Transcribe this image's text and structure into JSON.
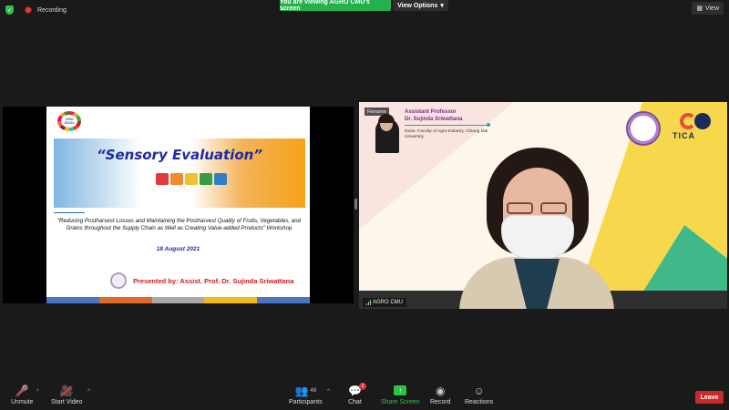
{
  "top": {
    "recording_label": "Recording",
    "banner_text": "You are viewing AGRO CMU's screen",
    "view_options_label": "View Options",
    "view_label": "View"
  },
  "slide": {
    "logo_text": "CMU SDGs",
    "title": "“Sensory Evaluation”",
    "workshop_text": "“Reducing Postharvest Losses and Maintaining the Postharvest Quality of Fruits, Vegetables, and Grains throughout the Supply Chain as Well as Creating Value-added Products” Workshop",
    "date": "18 August 2021",
    "presenter": "Presented by: Assist. Prof. Dr. Sujinda Sriwattana",
    "sense_colors": [
      "#e23a3a",
      "#f08a2a",
      "#f2c12e",
      "#3a9a47",
      "#2e7fc8"
    ],
    "footer_colors": [
      "#4a74c4",
      "#e06a2a",
      "#a8a8a8",
      "#f2b81e",
      "#4a74c4"
    ]
  },
  "speaker": {
    "rename_label": "Rename",
    "title_line1": "Assistant Professor",
    "title_line2": "Dr. Sujinda Sriwattana",
    "subtitle": "Dean, Faculty of Agro-Industry, Chiang Mai University",
    "org_logo": "TICA",
    "name_tag": "AGRO CMU"
  },
  "toolbar": {
    "unmute": "Unmute",
    "start_video": "Start Video",
    "participants": "Participants",
    "participant_count": "48",
    "chat": "Chat",
    "chat_badge": "2",
    "share_screen": "Share Screen",
    "record": "Record",
    "reactions": "Reactions",
    "leave": "Leave"
  }
}
